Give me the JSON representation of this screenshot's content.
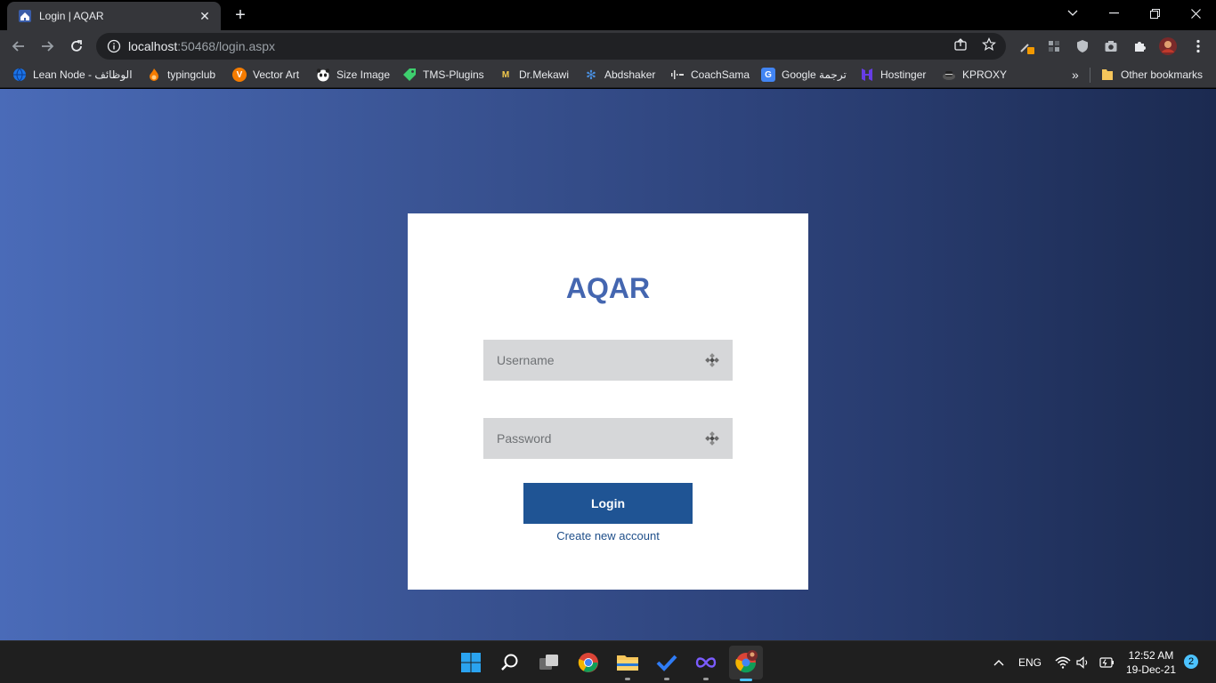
{
  "browser": {
    "tab": {
      "title": "Login | AQAR"
    },
    "url": {
      "host": "localhost",
      "rest": ":50468/login.aspx"
    }
  },
  "bookmarks": [
    {
      "label": "Lean Node - الوظائف",
      "icon": "globe-icon",
      "color": "#1a73e8"
    },
    {
      "label": "typingclub",
      "icon": "flame-icon",
      "color": "#f57c00"
    },
    {
      "label": "Vector Art",
      "icon": "vector-art-icon",
      "color": "#f57c00"
    },
    {
      "label": "Size Image",
      "icon": "panda-icon",
      "color": "#ffffff"
    },
    {
      "label": "TMS-Plugins",
      "icon": "tag-icon",
      "color": "#3ecf6e"
    },
    {
      "label": "Dr.Mekawi",
      "icon": "m-logo-icon",
      "color": "#f2c94c"
    },
    {
      "label": "Abdshaker",
      "icon": "snowflake-icon",
      "color": "#4a90e2"
    },
    {
      "label": "CoachSama",
      "icon": "bars-icon",
      "color": "#dddddd"
    },
    {
      "label": "Google ترجمة",
      "icon": "translate-icon",
      "color": "#4285f4"
    },
    {
      "label": "Hostinger",
      "icon": "hostinger-icon",
      "color": "#673de6"
    },
    {
      "label": "KPROXY",
      "icon": "kproxy-icon",
      "color": "#cccccc"
    }
  ],
  "other_bookmarks": "Other bookmarks",
  "login": {
    "brand": "AQAR",
    "username_placeholder": "Username",
    "password_placeholder": "Password",
    "button": "Login",
    "create_link": "Create new account"
  },
  "taskbar": {
    "language": "ENG",
    "time": "12:52 AM",
    "date": "19-Dec-21",
    "notifications": "2"
  },
  "colors": {
    "brand": "#4466b0",
    "button": "#1f5494",
    "link": "#1f4f8a",
    "field": "#d6d7d9"
  }
}
